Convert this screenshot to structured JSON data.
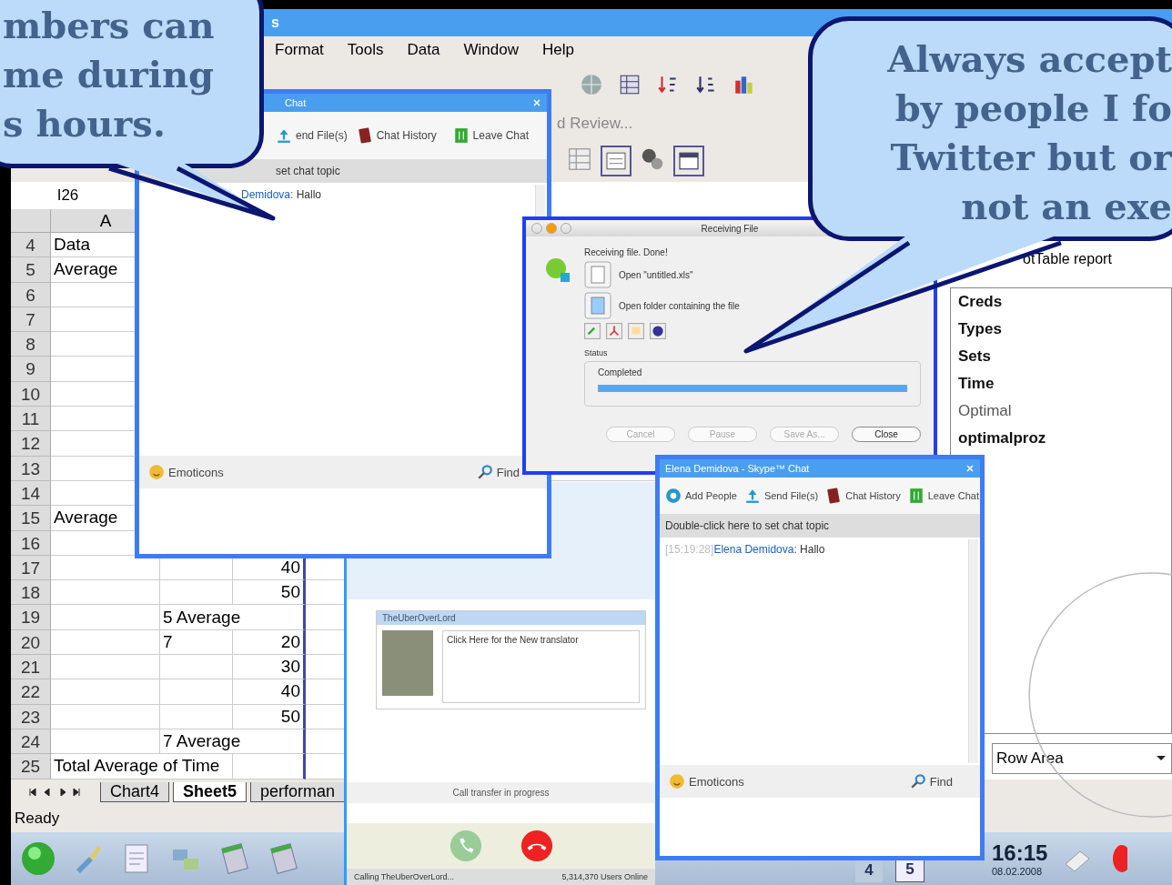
{
  "spreadsheet": {
    "title": "s",
    "menu": [
      "Format",
      "Tools",
      "Data",
      "Window",
      "Help"
    ],
    "review_label": "d Review...",
    "name_box": "I26",
    "column_header": "A",
    "rows": [
      {
        "number": "4",
        "a": "Data"
      },
      {
        "number": "5",
        "a": "Average"
      },
      {
        "number": "6"
      },
      {
        "number": "7"
      },
      {
        "number": "8"
      },
      {
        "number": "9"
      },
      {
        "number": "10"
      },
      {
        "number": "11"
      },
      {
        "number": "12"
      },
      {
        "number": "13"
      },
      {
        "number": "14"
      },
      {
        "number": "15",
        "a": "Average"
      },
      {
        "number": "16"
      },
      {
        "number": "17",
        "c": "40"
      },
      {
        "number": "18",
        "c": "50"
      },
      {
        "number": "19",
        "b": "5 Average"
      },
      {
        "number": "20",
        "b": "7",
        "c": "20"
      },
      {
        "number": "21",
        "c": "30"
      },
      {
        "number": "22",
        "c": "40"
      },
      {
        "number": "23",
        "c": "50"
      },
      {
        "number": "24",
        "b": "7 Average"
      },
      {
        "number": "25",
        "a": "Total Average of Time"
      }
    ],
    "pivot": {
      "heading": "otTable report",
      "fields": [
        {
          "label": "Creds",
          "bold": true
        },
        {
          "label": "Types",
          "bold": true
        },
        {
          "label": "Sets",
          "bold": true
        },
        {
          "label": "Time",
          "bold": true
        },
        {
          "label": "Optimal",
          "bold": false
        },
        {
          "label": "optimalproz",
          "bold": true
        }
      ],
      "area": "Row Area"
    },
    "sheet_tabs": [
      {
        "label": "Chart4",
        "selected": false
      },
      {
        "label": "Sheet5",
        "selected": true
      },
      {
        "label": "performan",
        "selected": false
      }
    ],
    "status": "Ready"
  },
  "call_window": {
    "contact": "TheUberOverLord",
    "message": "Click Here for the New translator",
    "progress_text": "Call transfer in progress",
    "status": "Calling TheUberOverLord...",
    "users_online": "5,314,370 Users Online"
  },
  "chat_windows": [
    {
      "title": "Chat",
      "toolbar": [
        {
          "kind": "send",
          "label": "end File(s)"
        },
        {
          "kind": "history",
          "label": "Chat History"
        },
        {
          "kind": "leave",
          "label": "Leave Chat"
        }
      ],
      "topic": "set chat topic",
      "messages": [
        {
          "sender": "Demidova:",
          "text": "Hallo"
        }
      ],
      "emoticons": "Emoticons",
      "find": "Find"
    },
    {
      "title": "Elena Demidova - Skype™ Chat",
      "toolbar": [
        {
          "kind": "add",
          "label": "Add People"
        },
        {
          "kind": "send",
          "label": "Send File(s)"
        },
        {
          "kind": "history",
          "label": "Chat History"
        },
        {
          "kind": "leave",
          "label": "Leave Chat"
        }
      ],
      "topic": "Double-click here to set chat topic",
      "messages": [
        {
          "time": "[15:19:28]",
          "sender": "Elena Demidova:",
          "text": "Hallo"
        }
      ],
      "emoticons": "Emoticons",
      "find": "Find"
    }
  ],
  "receiving_dialog": {
    "title": "Receiving File",
    "heading": "Receiving file. Done!",
    "actions": [
      "Open \"untitled.xls\"",
      "Open folder containing the file"
    ],
    "status_label": "Status",
    "progress_label": "Completed",
    "level": 1,
    "buttons": [
      {
        "label": "Cancel",
        "disabled": true
      },
      {
        "label": "Pause",
        "disabled": true
      },
      {
        "label": "Save As...",
        "disabled": true
      },
      {
        "label": "Close",
        "disabled": false
      }
    ]
  },
  "taskbar": {
    "pager": [
      {
        "label": "4",
        "selected": false
      },
      {
        "label": "5",
        "selected": true
      }
    ],
    "clock": "16:15",
    "date": "08.02.2008"
  },
  "callouts": [
    {
      "lines": [
        "mbers can",
        "me during",
        "s hours."
      ]
    },
    {
      "lines": [
        "Always accept",
        "by people I fo",
        "Twitter but or",
        "not an exe"
      ]
    }
  ]
}
